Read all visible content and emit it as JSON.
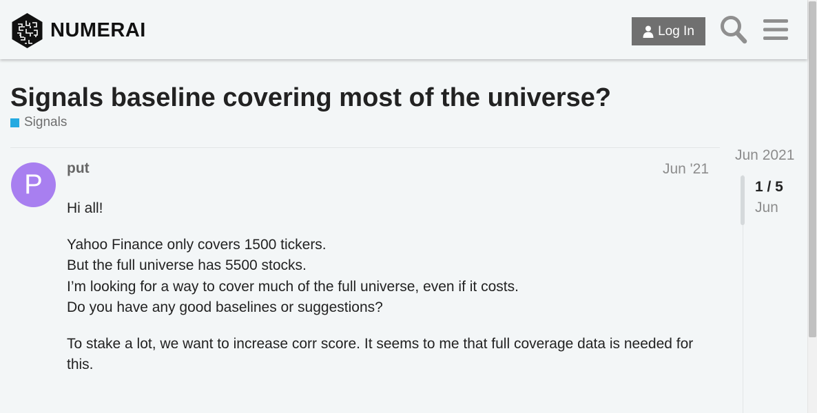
{
  "header": {
    "brand": "NUMERAI",
    "login_label": "Log In",
    "icons": {
      "login": "user-icon",
      "search": "search-icon",
      "menu": "hamburger-menu-icon"
    }
  },
  "topic": {
    "title": "Signals baseline covering most of the universe?",
    "category": {
      "name": "Signals",
      "color": "#25aae1"
    }
  },
  "post": {
    "author": "put",
    "avatar_letter": "P",
    "avatar_color": "#a87ff0",
    "date": "Jun '21",
    "paragraphs": [
      [
        "Hi all!"
      ],
      [
        "Yahoo Finance only covers 1500 tickers.",
        "But the full universe has 5500 stocks.",
        "I’m looking for a way to cover much of the full universe, even if it costs.",
        "Do you have any good baselines or suggestions?"
      ],
      [
        "To stake a lot, we want to increase corr score. It seems to me that full coverage data is needed for this."
      ]
    ]
  },
  "timeline": {
    "start_date": "Jun 2021",
    "position": "1 / 5",
    "current_date": "Jun"
  }
}
